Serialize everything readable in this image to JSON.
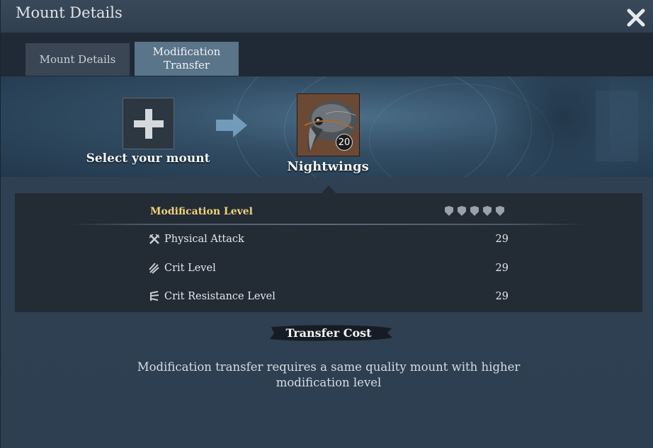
{
  "window": {
    "title": "Mount Details"
  },
  "tabs": [
    {
      "label": "Mount Details",
      "active": false
    },
    {
      "label": "Modification Transfer",
      "active": true
    }
  ],
  "source": {
    "label": "Select your mount",
    "icon": "plus-icon"
  },
  "target": {
    "name": "Nightwings",
    "level": "20",
    "icon": "bird-head-portrait"
  },
  "stats": {
    "header": "Modification Level",
    "stars_filled": 0,
    "stars_total": 5,
    "rows": [
      {
        "icon": "crossed-swords-icon",
        "label": "Physical Attack",
        "value": "29"
      },
      {
        "icon": "claw-slash-icon",
        "label": "Crit Level",
        "value": "29"
      },
      {
        "icon": "shield-spike-icon",
        "label": "Crit Resistance Level",
        "value": "29"
      }
    ]
  },
  "cost": {
    "label": "Transfer Cost"
  },
  "message": "Modification transfer requires a same quality mount with higher modification level",
  "colors": {
    "accent_gold": "#f0d37a",
    "active_tab": "#5a7489",
    "panel": "#232b35"
  }
}
